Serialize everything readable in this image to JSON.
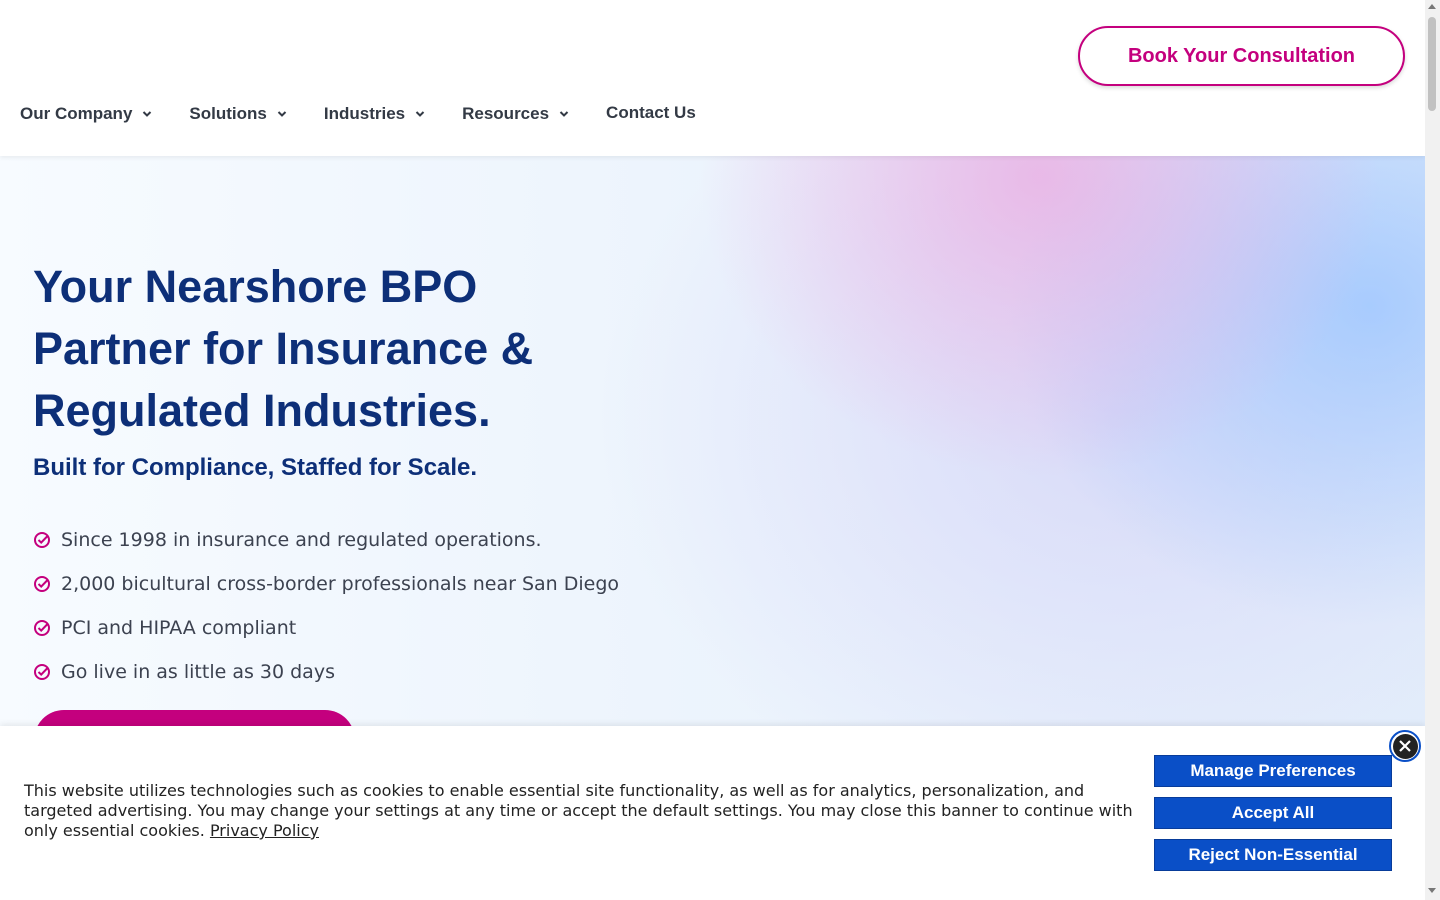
{
  "header": {
    "cta_label": "Book Your Consultation",
    "nav": [
      {
        "label": "Our Company"
      },
      {
        "label": "Solutions"
      },
      {
        "label": "Industries"
      },
      {
        "label": "Resources"
      },
      {
        "label": "Contact Us"
      }
    ]
  },
  "hero": {
    "title": "Your Nearshore BPO Partner for Insurance & Regulated Industries.",
    "subtitle": "Built for Compliance, Staffed for Scale.",
    "bullets": [
      "Since 1998 in insurance and regulated operations.",
      "2,000 bicultural cross-border professionals near San Diego",
      "PCI and HIPAA compliant",
      "Go live in as little as 30 days"
    ]
  },
  "cookie": {
    "text": "This website utilizes technologies such as cookies to enable essential site functionality, as well as for analytics, personalization, and targeted advertising. You may change your settings at any time or accept the default settings. You may close this banner to continue with only essential cookies.",
    "link_label": "Privacy Policy",
    "manage_label": "Manage Preferences",
    "accept_label": "Accept All",
    "reject_label": "Reject Non-Essential"
  },
  "colors": {
    "brand_magenta": "#c4007e",
    "brand_navy": "#0d2f78",
    "cookie_button": "#0a4fc7"
  }
}
